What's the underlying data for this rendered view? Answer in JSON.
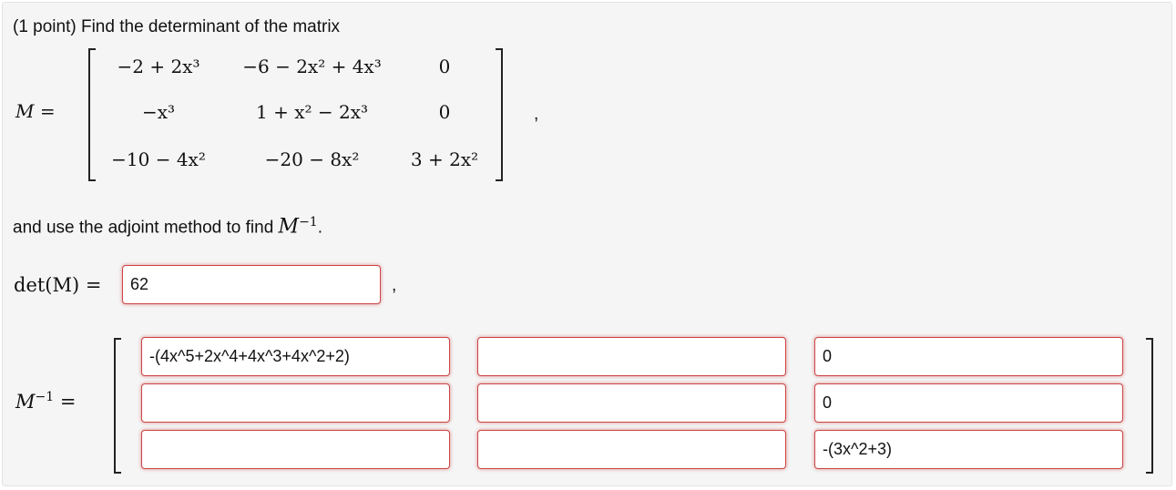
{
  "problem": {
    "intro": "(1 point) Find the determinant of the matrix",
    "m_label": "M =",
    "matrix": [
      [
        "−2 + 2x³",
        "−6 − 2x² + 4x³",
        "0"
      ],
      [
        "−x³",
        "1 + x² − 2x³",
        "0"
      ],
      [
        "−10 − 4x²",
        "−20 − 8x²",
        "3 + 2x²"
      ]
    ],
    "comma1": ",",
    "instruction": "and use the adjoint method to find",
    "instruction_math": "M",
    "instruction_sup": "−1",
    "instruction_end": ".",
    "det_label": "det(M) =",
    "comma2": ",",
    "inv_label_main": "M",
    "inv_label_sup": "−1",
    "inv_label_eq": "="
  },
  "answers": {
    "det_value": "62",
    "inverse": [
      [
        "-(4x^5+2x^4+4x^3+4x^2+2)",
        "",
        "0"
      ],
      [
        "",
        "",
        "0"
      ],
      [
        "",
        "",
        "-(3x^2+3)"
      ]
    ]
  },
  "colors": {
    "panel_bg": "#f5f5f5",
    "input_border_error": "#cc4444"
  }
}
